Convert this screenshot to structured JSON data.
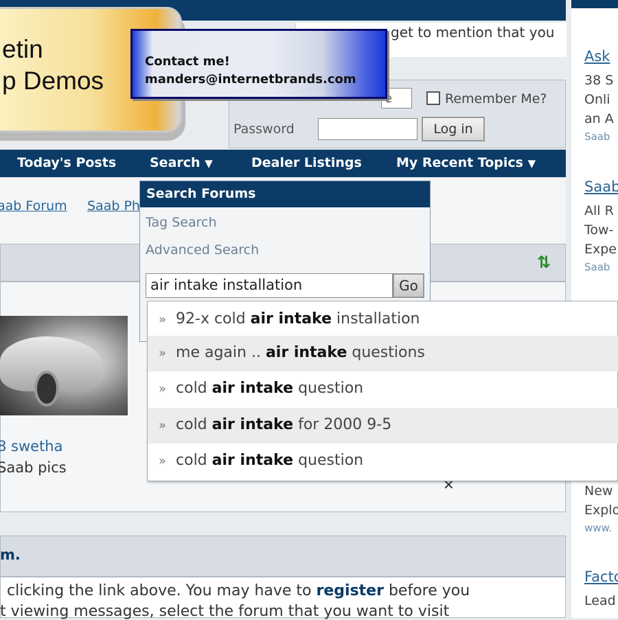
{
  "header": {
    "logo_line1": "etin",
    "logo_line2": "p Demos",
    "top_snippet": "get to mention that you"
  },
  "contact_card": {
    "line1": "Contact me!",
    "line2": "manders@internetbrands.com"
  },
  "login": {
    "username_partial": "e",
    "remember_label": "Remember Me?",
    "password_label": "Password",
    "login_button": "Log in"
  },
  "navbar": {
    "items": [
      "Today's Posts",
      "Search",
      "Dealer Listings",
      "My Recent Topics"
    ]
  },
  "breadcrumbs": [
    "aab Forum",
    "Saab Ph"
  ],
  "search_menu": {
    "title": "Search Forums",
    "tag_search": "Tag Search",
    "advanced_search": "Advanced Search",
    "query": "air intake installation",
    "go_button": "Go"
  },
  "autocomplete": [
    {
      "pre": "92-x cold ",
      "bold": "air intake",
      "post": " installation"
    },
    {
      "pre": "me again .. ",
      "bold": "air intake",
      "post": " questions"
    },
    {
      "pre": "cold ",
      "bold": "air intake",
      "post": " question"
    },
    {
      "pre": "cold ",
      "bold": "air intake",
      "post": " for 2000 9-5"
    },
    {
      "pre": "cold ",
      "bold": "air intake",
      "post": " question"
    }
  ],
  "gallery": {
    "user": "8 swetha",
    "subtitle": "Saab pics"
  },
  "welcome": {
    "title": "m.",
    "text1_pre": "clicking the link above. You may have to ",
    "text1_link": "register",
    "text1_post": " before you",
    "text2": "t viewing messages, select the forum that you want to visit"
  },
  "sidebar": {
    "ad1_title": "Ask",
    "ad1_lines": [
      "38 S",
      "Onli",
      "an A"
    ],
    "ad1_url": "Saab",
    "ad2_title": "Saab",
    "ad2_lines": [
      "All R",
      "Tow-",
      "Expe"
    ],
    "ad2_url": "Saab",
    "ad3_lines": [
      "New",
      "Explo"
    ],
    "ad3_url": "www.",
    "ad4_title": "Facto",
    "ad4_lines": [
      "Lead"
    ]
  },
  "colors": {
    "navbar": "#0b3b66",
    "link": "#2a6496"
  }
}
